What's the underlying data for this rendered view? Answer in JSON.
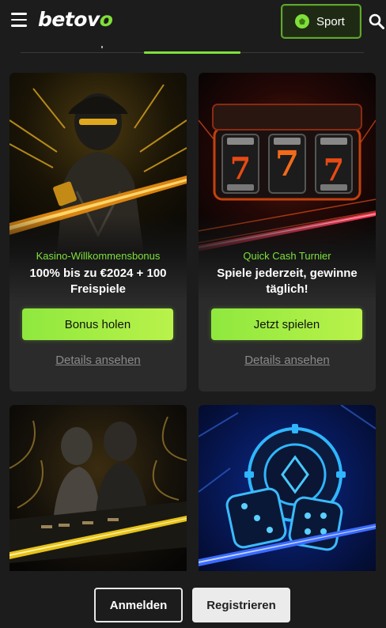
{
  "header": {
    "logo_main": "betov",
    "logo_accent": "o",
    "sport_label": "Sport"
  },
  "colors": {
    "accent": "#7ee03a",
    "background": "#1c1c1c",
    "card": "#2b2b2b"
  },
  "cards": [
    {
      "subtitle": "Kasino-Willkommensbonus",
      "title": "100% bis zu €2024 + 100 Freispiele",
      "cta": "Bonus holen",
      "details": "Details ansehen",
      "image": "masked-man-with-cards"
    },
    {
      "subtitle": "Quick Cash Turnier",
      "title": "Spiele jederzeit, gewinne täglich!",
      "cta": "Jetzt spielen",
      "details": "Details ansehen",
      "image": "slot-reels-777"
    },
    {
      "image": "couple-at-card-table"
    },
    {
      "image": "neon-chip-and-dice"
    }
  ],
  "footer": {
    "login_label": "Anmelden",
    "register_label": "Registrieren"
  }
}
